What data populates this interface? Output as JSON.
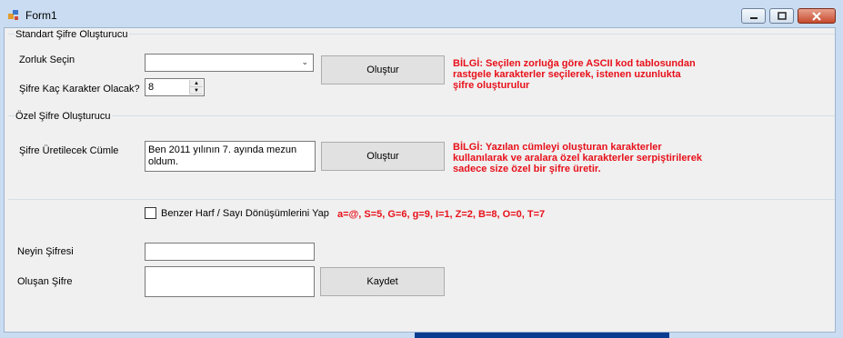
{
  "window": {
    "title": "Form1",
    "icon": "form-app-icon"
  },
  "standard_group": {
    "title": "Standart Şifre Oluşturucu",
    "difficulty_label": "Zorluk Seçin",
    "difficulty_value": "",
    "length_label": "Şifre Kaç Karakter Olacak?",
    "length_value": "8",
    "generate_label": "Oluştur",
    "info_line1": "BİLGİ: Seçilen zorluğa göre ASCII kod tablosundan",
    "info_line2": "rastgele karakterler seçilerek, istenen uzunlukta",
    "info_line3": "şifre oluşturulur"
  },
  "custom_group": {
    "title": "Özel Şifre Oluşturucu",
    "sentence_label": "Şifre Üretilecek Cümle",
    "sentence_value": "Ben 2011 yılının 7. ayında mezun oldum.",
    "generate_label": "Oluştur",
    "info_line1": "BİLGİ: Yazılan cümleyi oluşturan karakterler",
    "info_line2": "kullanılarak ve aralara özel karakterler serpiştirilerek",
    "info_line3": "sadece size özel bir şifre üretir."
  },
  "options": {
    "substitution_label": "Benzer Harf / Sayı Dönüşümlerini Yap",
    "substitution_checked": false,
    "substitution_map": "a=@, S=5, G=6, g=9, I=1,  Z=2, B=8, O=0, T=7"
  },
  "output": {
    "target_label": "Neyin Şifresi",
    "target_value": "",
    "result_label": "Oluşan Şifre",
    "result_value": "",
    "save_label": "Kaydet"
  },
  "colors": {
    "info_text": "#e8101a",
    "client_bg": "#f0f0f0",
    "frame": "#c9dcf1"
  }
}
